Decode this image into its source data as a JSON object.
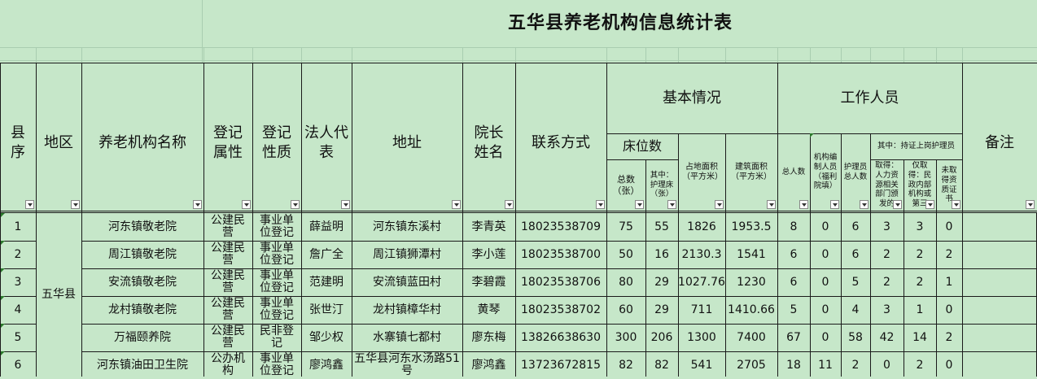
{
  "title": "五华县养老机构信息统计表",
  "headers": {
    "county_seq": "县序",
    "region": "地区",
    "name": "养老机构名称",
    "reg_attr": "登记属性",
    "reg_nature": "登记性质",
    "legal_rep": "法人代表",
    "address": "地址",
    "director": "院长姓名",
    "contact": "联系方式",
    "basic_info": "基本情况",
    "beds": "床位数",
    "total_beds": "总数（张）",
    "care_beds": "其中：护理床（张）",
    "land_area": "占地面积（平方米）",
    "building_area": "建筑面积（平方米）",
    "staff": "工作人员",
    "total_staff": "总人数",
    "institution_staff": "机构编制人员（福利院填）",
    "caregiver_total": "护理员总人数",
    "certified_note": "其中：持证上岗护理员",
    "cert_hr": "取得：人力资源相关部门颁发的",
    "cert_civil": "仅取得：民政内部机构或第三",
    "no_cert": "未取得资质证书",
    "remarks": "备注"
  },
  "region_value": "五华县",
  "rows": [
    {
      "seq": "1",
      "name": "河东镇敬老院",
      "attr": "公建民营",
      "nature": "事业单位登记",
      "rep": "薛益明",
      "addr": "河东镇东溪村",
      "director": "李青英",
      "phone": "18023538709",
      "total_beds": "75",
      "care_beds": "55",
      "land": "1826",
      "building": "1953.5",
      "staff": "8",
      "inst": "0",
      "care": "6",
      "hr": "3",
      "civil": "3",
      "none": "0"
    },
    {
      "seq": "2",
      "name": "周江镇敬老院",
      "attr": "公建民营",
      "nature": "事业单位登记",
      "rep": "詹广全",
      "addr": "周江镇狮潭村",
      "director": "李小莲",
      "phone": "18023538700",
      "total_beds": "50",
      "care_beds": "16",
      "land": "2130.3",
      "building": "1541",
      "staff": "6",
      "inst": "0",
      "care": "6",
      "hr": "2",
      "civil": "2",
      "none": "2"
    },
    {
      "seq": "3",
      "name": "安流镇敬老院",
      "attr": "公建民营",
      "nature": "事业单位登记",
      "rep": "范建明",
      "addr": "安流镇蓝田村",
      "director": "李碧霞",
      "phone": "18023538706",
      "total_beds": "80",
      "care_beds": "29",
      "land": "1027.76",
      "building": "1230",
      "staff": "6",
      "inst": "0",
      "care": "5",
      "hr": "2",
      "civil": "2",
      "none": "1"
    },
    {
      "seq": "4",
      "name": "龙村镇敬老院",
      "attr": "公建民营",
      "nature": "事业单位登记",
      "rep": "张世汀",
      "addr": "龙村镇樟华村",
      "director": "黄琴",
      "phone": "18023538702",
      "total_beds": "60",
      "care_beds": "29",
      "land": "711",
      "building": "1410.66",
      "staff": "5",
      "inst": "0",
      "care": "4",
      "hr": "3",
      "civil": "1",
      "none": "0"
    },
    {
      "seq": "5",
      "name": "万福颐养院",
      "attr": "公建民营",
      "nature": "民非登记",
      "rep": "邹少权",
      "addr": "水寨镇七都村",
      "director": "廖东梅",
      "phone": "13826638630",
      "total_beds": "300",
      "care_beds": "206",
      "land": "1300",
      "building": "7400",
      "staff": "67",
      "inst": "0",
      "care": "58",
      "hr": "42",
      "civil": "14",
      "none": "2"
    },
    {
      "seq": "6",
      "name": "河东镇油田卫生院",
      "attr": "公办机构",
      "nature": "事业单位登记",
      "rep": "廖鸿鑫",
      "addr": "五华县河东水汤路51号",
      "director": "廖鸿鑫",
      "phone": "13723672815",
      "total_beds": "82",
      "care_beds": "82",
      "land": "541",
      "building": "2705",
      "staff": "18",
      "inst": "11",
      "care": "2",
      "hr": "0",
      "civil": "2",
      "none": "0"
    }
  ]
}
